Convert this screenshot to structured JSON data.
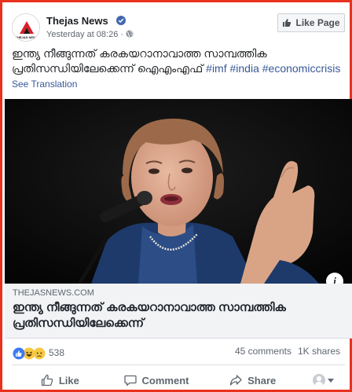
{
  "post": {
    "page_name": "Thejas News",
    "timestamp": "Yesterday at 08:26",
    "separator": "·",
    "like_page_label": "Like Page",
    "text_line1": "ഇന്ത്യ നീങ്ങുന്നത് കരകയറാനാവാത്ത സാമ്പത്തിക",
    "text_line2_plain": "പ്രതിസന്ധിയിലേക്കെന്ന് ഐഎംഎഫ് ",
    "hashtags": "#imf #india #economiccrisis",
    "see_translation": "See Translation",
    "logo_text": "THEJAS NEWS"
  },
  "link_preview": {
    "domain": "THEJASNEWS.COM",
    "title": "ഇന്ത്യ നീങ്ങുന്നത് കരകയറാനാവാത്ത സാമ്പത്തിക പ്രതിസന്ധിയിലേക്കെന്ന്",
    "info_label": "i"
  },
  "engagement": {
    "reaction_count": "538",
    "reaction_types": [
      "like",
      "haha",
      "sad"
    ],
    "comments": "45 comments",
    "shares": "1K shares"
  },
  "actions": {
    "like": "Like",
    "comment": "Comment",
    "share": "Share"
  },
  "colors": {
    "frame_border": "#e8321e",
    "link_blue": "#385898",
    "like_blue": "#4267b2"
  }
}
